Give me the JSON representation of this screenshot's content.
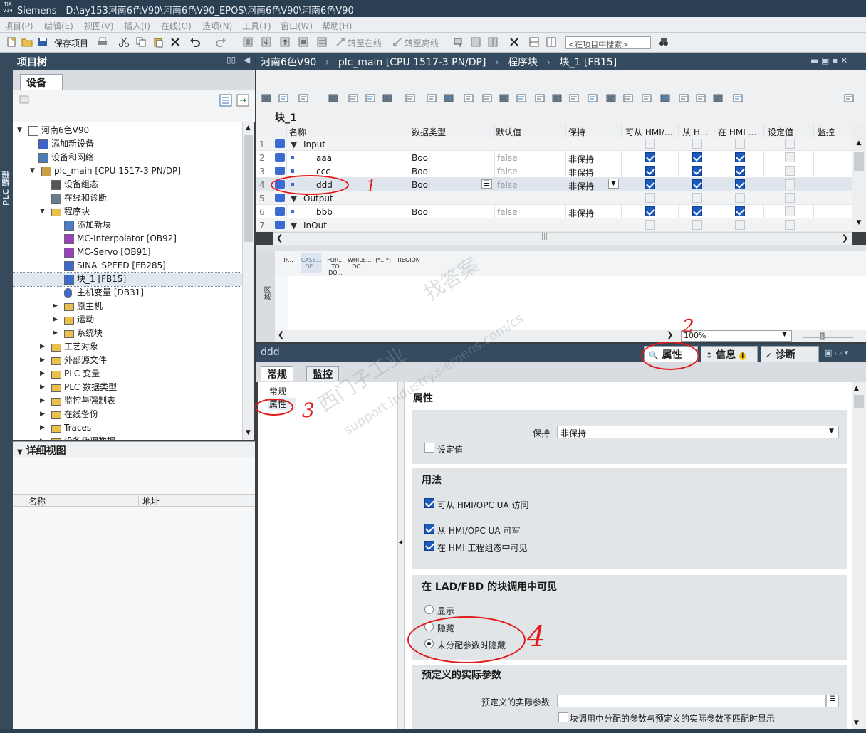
{
  "window": {
    "logo": "TIA V14",
    "title": "Siemens   -   D:\\ay153河南6色V90\\河南6色V90_EPOS\\河南6色V90\\河南6色V90"
  },
  "menu": [
    "项目(P)",
    "编辑(E)",
    "视图(V)",
    "插入(I)",
    "在线(O)",
    "选项(N)",
    "工具(T)",
    "窗口(W)",
    "帮助(H)"
  ],
  "toolbar": {
    "save_project": "保存项目",
    "go_online": "转至在线",
    "go_offline": "转至离线",
    "search_placeholder": "<在项目中搜索>"
  },
  "left_strip_label": "PLC 编程",
  "project_tree": {
    "title": "项目树",
    "tab": "设备",
    "items": [
      {
        "label": "河南6色V90",
        "icon": "project-icon"
      },
      {
        "label": "添加新设备",
        "icon": "add-device-icon"
      },
      {
        "label": "设备和网络",
        "icon": "network-icon"
      },
      {
        "label": "plc_main [CPU 1517-3 PN/DP]",
        "icon": "plc-icon"
      },
      {
        "label": "设备组态",
        "icon": "device-config-icon"
      },
      {
        "label": "在线和诊断",
        "icon": "online-diag-icon"
      },
      {
        "label": "程序块",
        "icon": "folder-icon"
      },
      {
        "label": "添加新块",
        "icon": "add-block-icon"
      },
      {
        "label": "MC-Interpolator [OB92]",
        "icon": "ob-icon"
      },
      {
        "label": "MC-Servo [OB91]",
        "icon": "ob-icon"
      },
      {
        "label": "SINA_SPEED [FB285]",
        "icon": "fb-icon"
      },
      {
        "label": "块_1 [FB15]",
        "icon": "fb-icon"
      },
      {
        "label": "主机变量 [DB31]",
        "icon": "db-icon"
      },
      {
        "label": "原主机",
        "icon": "folder-icon"
      },
      {
        "label": "运动",
        "icon": "folder-icon"
      },
      {
        "label": "系统块",
        "icon": "folder-icon"
      },
      {
        "label": "工艺对象",
        "icon": "folder-icon"
      },
      {
        "label": "外部源文件",
        "icon": "folder-icon"
      },
      {
        "label": "PLC 变量",
        "icon": "folder-icon"
      },
      {
        "label": "PLC 数据类型",
        "icon": "folder-icon"
      },
      {
        "label": "监控与强制表",
        "icon": "folder-icon"
      },
      {
        "label": "在线备份",
        "icon": "folder-icon"
      },
      {
        "label": "Traces",
        "icon": "folder-icon"
      },
      {
        "label": "设备代理数据",
        "icon": "folder-icon"
      }
    ]
  },
  "detail_view": {
    "title": "详细视图",
    "col_name": "名称",
    "col_address": "地址"
  },
  "editor": {
    "breadcrumb": [
      "河南6色V90",
      "plc_main [CPU 1517-3 PN/DP]",
      "程序块",
      "块_1 [FB15]"
    ],
    "block_name": "块_1",
    "columns": [
      "名称",
      "数据类型",
      "默认值",
      "保持",
      "可从 HMI/...",
      "从 H...",
      "在 HMI ...",
      "设定值",
      "监控"
    ],
    "rows": [
      {
        "num": "1",
        "name": "Input",
        "type": "",
        "default": "",
        "retain": ""
      },
      {
        "num": "2",
        "name": "aaa",
        "type": "Bool",
        "default": "false",
        "retain": "非保持"
      },
      {
        "num": "3",
        "name": "ccc",
        "type": "Bool",
        "default": "false",
        "retain": "非保持"
      },
      {
        "num": "4",
        "name": "ddd",
        "type": "Bool",
        "default": "false",
        "retain": "非保持"
      },
      {
        "num": "5",
        "name": "Output",
        "type": "",
        "default": "",
        "retain": ""
      },
      {
        "num": "6",
        "name": "bbb",
        "type": "Bool",
        "default": "false",
        "retain": "非保持"
      },
      {
        "num": "7",
        "name": "InOut",
        "type": "",
        "default": "",
        "retain": ""
      }
    ],
    "code_toolbar": [
      {
        "l1": "IF...",
        "l2": ""
      },
      {
        "l1": "CASE...",
        "l2": "OF..."
      },
      {
        "l1": "FOR...",
        "l2": "TO DO..."
      },
      {
        "l1": "WHILE...",
        "l2": "DO..."
      },
      {
        "l1": "(*...*)",
        "l2": ""
      },
      {
        "l1": "REGION",
        "l2": ""
      }
    ],
    "code_side_label": "区域",
    "code_line": "1",
    "zoom": "100%"
  },
  "inspector": {
    "object": "ddd",
    "tabs": {
      "properties": "属性",
      "info": "信息",
      "diagnostics": "诊断"
    },
    "subtabs": {
      "general": "常规",
      "monitor": "监控"
    },
    "nav": {
      "general": "常规",
      "attributes": "属性"
    },
    "section_title": "属性",
    "retain_label": "保持",
    "retain_value": "非保持",
    "setpoint_label": "设定值",
    "usage_title": "用法",
    "usage": [
      "可从 HMI/OPC UA 访问",
      "从 HMI/OPC UA 可写",
      "在 HMI 工程组态中可见"
    ],
    "visibility_title": "在 LAD/FBD 的块调用中可见",
    "visibility": [
      "显示",
      "隐藏",
      "未分配参数时隐藏"
    ],
    "predefined_title": "预定义的实际参数",
    "predefined_label": "预定义的实际参数",
    "predefined_value": "",
    "mismatch_label": "块调用中分配的参数与预定义的实际参数不匹配时显示"
  },
  "annotations": [
    "1",
    "2",
    "3",
    "3",
    "4"
  ],
  "watermark": [
    "西门子工业",
    "找答案",
    "support.industry.siemens.com/cs"
  ]
}
